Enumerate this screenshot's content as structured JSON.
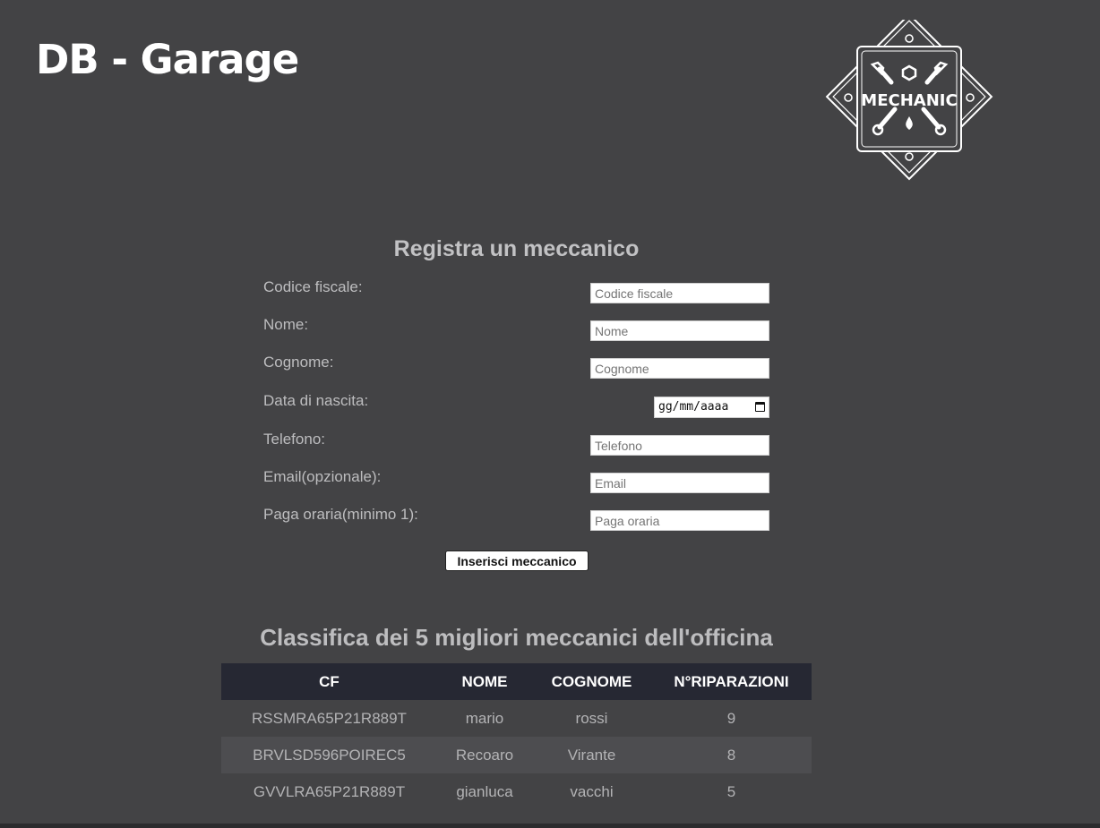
{
  "header": {
    "title": "DB - Garage",
    "logo_text": "MECHANIC"
  },
  "form": {
    "title": "Registra un meccanico",
    "fields": [
      {
        "label": "Codice fiscale:",
        "placeholder": "Codice fiscale",
        "value": ""
      },
      {
        "label": "Nome:",
        "placeholder": "Nome",
        "value": ""
      },
      {
        "label": "Cognome:",
        "placeholder": "Cognome",
        "value": ""
      },
      {
        "label": "Data di nascita:",
        "placeholder": "gg/mm/aaaa",
        "value": ""
      },
      {
        "label": "Telefono:",
        "placeholder": "Telefono",
        "value": ""
      },
      {
        "label": "Email(opzionale):",
        "placeholder": "Email",
        "value": ""
      },
      {
        "label": "Paga oraria(minimo 1):",
        "placeholder": "Paga oraria",
        "value": ""
      }
    ],
    "submit_label": "Inserisci meccanico"
  },
  "ranking": {
    "title": "Classifica dei 5 migliori meccanici dell'officina",
    "columns": [
      "CF",
      "NOME",
      "COGNOME",
      "N°RIPARAZIONI"
    ],
    "rows": [
      [
        "RSSMRA65P21R889T",
        "mario",
        "rossi",
        "9"
      ],
      [
        "BRVLSD596POIREC5",
        "Recoaro",
        "Virante",
        "8"
      ],
      [
        "GVVLRA65P21R889T",
        "gianluca",
        "vacchi",
        "5"
      ]
    ]
  },
  "colors": {
    "background": "#434345",
    "table_header": "#262833",
    "table_alt_row": "#4d4d50"
  }
}
